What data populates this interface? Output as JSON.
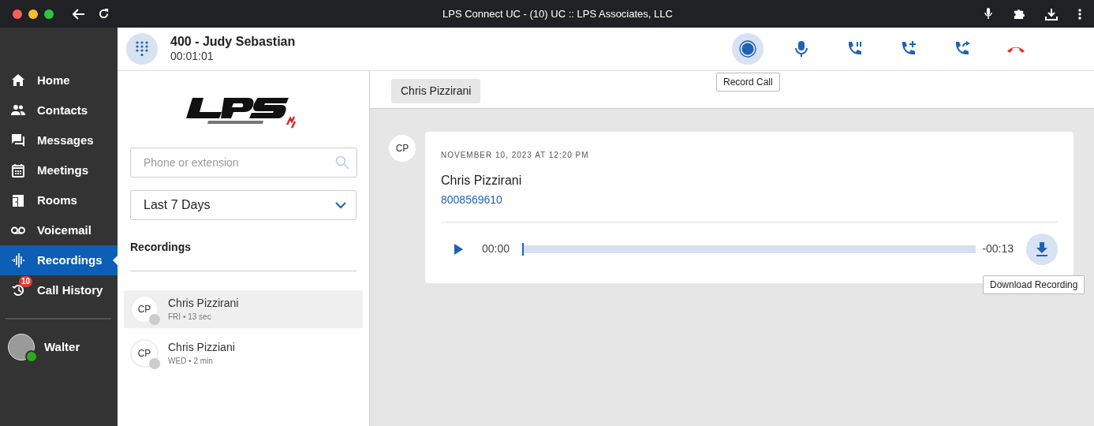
{
  "window": {
    "title": "LPS Connect UC - (10) UC :: LPS Associates, LLC"
  },
  "sidebar": {
    "items": [
      {
        "kind": "home",
        "label": "Home",
        "selected": false
      },
      {
        "kind": "contacts",
        "label": "Contacts",
        "selected": false
      },
      {
        "kind": "messages",
        "label": "Messages",
        "selected": false
      },
      {
        "kind": "meetings",
        "label": "Meetings",
        "selected": false
      },
      {
        "kind": "rooms",
        "label": "Rooms",
        "selected": false
      },
      {
        "kind": "voicemail",
        "label": "Voicemail",
        "selected": false
      },
      {
        "kind": "recordings",
        "label": "Recordings",
        "selected": true
      },
      {
        "kind": "history",
        "label": "Call History",
        "selected": false,
        "badge": "10"
      }
    ],
    "user": {
      "name": "Walter",
      "online": true
    }
  },
  "call": {
    "title": "400 - Judy Sebastian",
    "duration": "00:01:01",
    "controls": [
      {
        "kind": "record",
        "active": true,
        "tooltip": "Record Call"
      },
      {
        "kind": "mute",
        "active": false
      },
      {
        "kind": "hold",
        "active": false
      },
      {
        "kind": "add",
        "active": false
      },
      {
        "kind": "transfer",
        "active": false
      },
      {
        "kind": "hangup",
        "active": false
      }
    ]
  },
  "left_panel": {
    "search": {
      "placeholder": "Phone or extension"
    },
    "filter": "Last 7 Days",
    "section_title": "Recordings",
    "recordings": [
      {
        "initials": "CP",
        "name": "Chris Pizzirani",
        "meta": "FRI • 13 sec",
        "selected": true
      },
      {
        "initials": "CP",
        "name": "Chris Pizziani",
        "meta": "WED • 2 min",
        "selected": false
      }
    ]
  },
  "main": {
    "tab": "Chris Pizzirani",
    "message": {
      "initials": "CP",
      "timestamp": "NOVEMBER 10, 2023 AT 12:20 PM",
      "name": "Chris Pizzirani",
      "number": "8008569610",
      "player": {
        "elapsed": "00:00",
        "remaining": "-00:13",
        "level": 0
      },
      "download_tooltip": "Download Recording"
    }
  }
}
